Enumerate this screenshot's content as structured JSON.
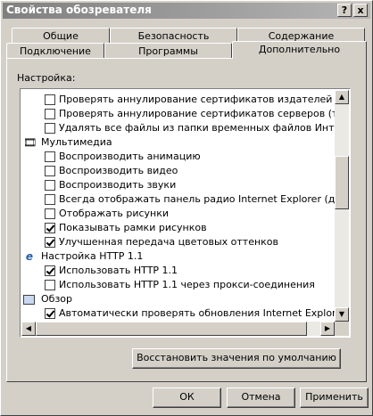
{
  "window": {
    "title": "Свойства обозревателя",
    "help_label": "?",
    "close_label": "x"
  },
  "tabs_row1": [
    {
      "label": "Общие"
    },
    {
      "label": "Безопасность"
    },
    {
      "label": "Содержание"
    }
  ],
  "tabs_row2": [
    {
      "label": "Подключение"
    },
    {
      "label": "Программы"
    },
    {
      "label": "Дополнительно",
      "active": true
    }
  ],
  "settings": {
    "label": "Настройка:",
    "items": [
      {
        "type": "checkbox",
        "checked": false,
        "label": "Проверять аннулирование сертификатов издателей"
      },
      {
        "type": "checkbox",
        "checked": false,
        "label": "Проверять аннулирование сертификатов серверов (требуется перезагрузка)"
      },
      {
        "type": "checkbox",
        "checked": false,
        "label": "Удалять все файлы из папки временных файлов Интернета"
      },
      {
        "type": "category",
        "icon": "multimedia-icon",
        "label": "Мультимедиа"
      },
      {
        "type": "checkbox",
        "checked": false,
        "label": "Воспроизводить анимацию"
      },
      {
        "type": "checkbox",
        "checked": false,
        "label": "Воспроизводить видео"
      },
      {
        "type": "checkbox",
        "checked": false,
        "label": "Воспроизводить звуки"
      },
      {
        "type": "checkbox",
        "checked": false,
        "label": "Всегда отображать панель радио Internet Explorer (для вер"
      },
      {
        "type": "checkbox",
        "checked": false,
        "label": "Отображать рисунки"
      },
      {
        "type": "checkbox",
        "checked": true,
        "label": "Показывать рамки рисунков"
      },
      {
        "type": "checkbox",
        "checked": true,
        "label": "Улучшенная передача цветовых оттенков"
      },
      {
        "type": "category",
        "icon": "ie-icon",
        "label": "Настройка HTTP 1.1"
      },
      {
        "type": "checkbox",
        "checked": true,
        "label": "Использовать HTTP 1.1"
      },
      {
        "type": "checkbox",
        "checked": false,
        "label": "Использовать HTTP 1.1 через прокси-соединения"
      },
      {
        "type": "category",
        "icon": "browse-icon",
        "label": "Обзор"
      },
      {
        "type": "checkbox",
        "checked": true,
        "label": "Автоматически проверять обновления Internet Explorer."
      }
    ]
  },
  "scroll": {
    "vertical_position": 0.2
  },
  "buttons": {
    "restore_defaults": "Восстановить значения по умолчанию",
    "ok": "ОК",
    "cancel": "Отмена",
    "apply": "Применить"
  },
  "arrows": {
    "up": "▲",
    "down": "▼",
    "left": "◀",
    "right": "▶"
  }
}
